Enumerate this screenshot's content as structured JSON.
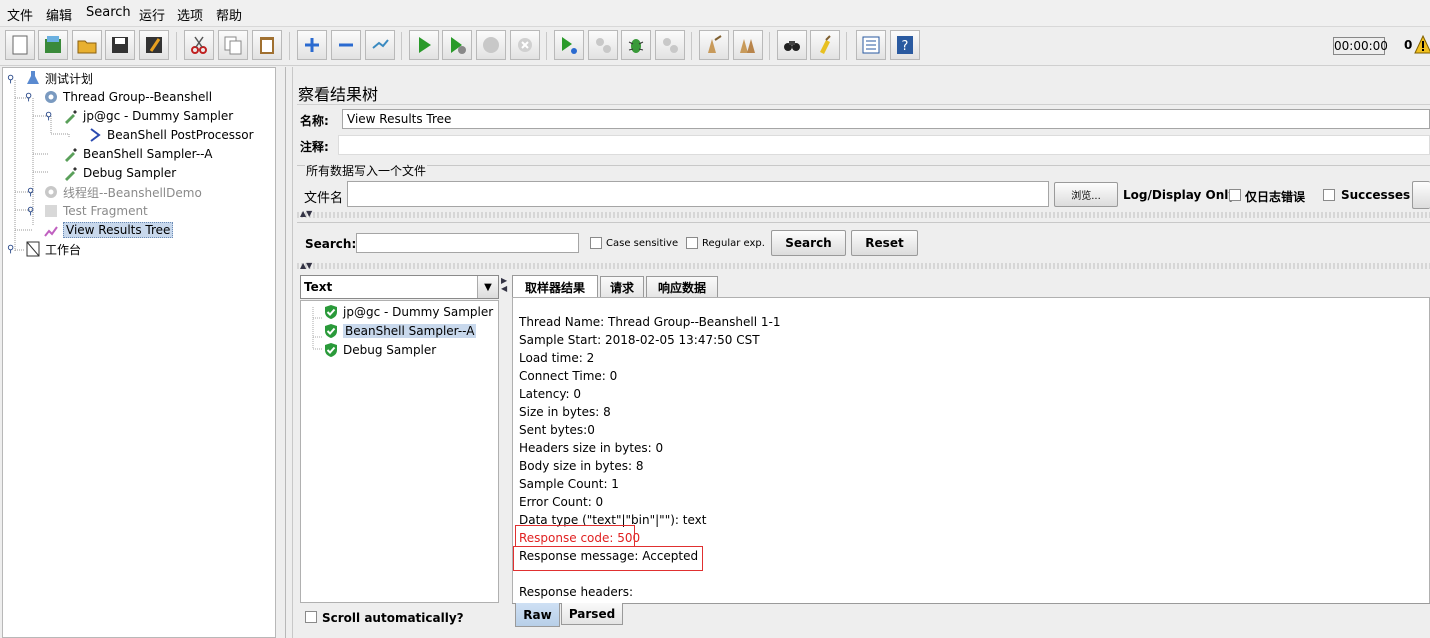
{
  "menu": [
    "文件",
    "编辑",
    "Search",
    "运行",
    "选项",
    "帮助"
  ],
  "toolbar": {
    "timer": "00:00:00",
    "warning_count": "0",
    "buttons": [
      "new-icon",
      "templates-icon",
      "open-icon",
      "save-icon",
      "save-as-icon",
      "cut-icon",
      "copy-icon",
      "paste-icon",
      "expand-icon",
      "collapse-icon",
      "toggle-icon",
      "start-icon",
      "start-no-pause-icon",
      "stop-icon",
      "shutdown-icon",
      "remote-start-icon",
      "remote-stop-icon",
      "remote-bug-icon",
      "remote-shutdown-icon",
      "clear-icon",
      "clear-all-icon",
      "search-icon",
      "reset-search-icon",
      "function-helper-icon",
      "help-icon"
    ]
  },
  "tree": [
    {
      "label": "测试计划",
      "icon": "flask-icon",
      "style": "normal"
    },
    {
      "label": "Thread Group--Beanshell",
      "icon": "gear-icon",
      "style": "normal"
    },
    {
      "label": "jp@gc - Dummy Sampler",
      "icon": "pipette-icon",
      "style": "normal"
    },
    {
      "label": "BeanShell PostProcessor",
      "icon": "arrow-icon",
      "style": "normal"
    },
    {
      "label": "BeanShell Sampler--A",
      "icon": "pipette-icon",
      "style": "normal"
    },
    {
      "label": "Debug Sampler",
      "icon": "pipette-icon",
      "style": "normal"
    },
    {
      "label": "线程组--BeanshellDemo",
      "icon": "gear-icon",
      "style": "disabled"
    },
    {
      "label": "Test Fragment",
      "icon": "fragment-icon",
      "style": "disabled"
    },
    {
      "label": "View Results Tree",
      "icon": "chart-icon",
      "style": "selected"
    },
    {
      "label": "工作台",
      "icon": "workbench-icon",
      "style": "normal"
    }
  ],
  "panel": {
    "title": "察看结果树",
    "name_label": "名称:",
    "name_value": "View Results Tree",
    "comment_label": "注释:",
    "comment_value": "",
    "file_section": "所有数据写入一个文件",
    "file_label": "文件名",
    "file_value": "",
    "browse_label": "浏览...",
    "log_display_label": "Log/Display Only:",
    "errors_only_label": "仅日志错误",
    "successes_label": "Successes"
  },
  "search": {
    "label": "Search:",
    "value": "",
    "case_sensitive_label": "Case sensitive",
    "regex_label": "Regular exp.",
    "search_button": "Search",
    "reset_button": "Reset"
  },
  "renderer": {
    "selected": "Text"
  },
  "results": [
    {
      "label": "jp@gc - Dummy Sampler",
      "status": "success"
    },
    {
      "label": "BeanShell Sampler--A",
      "status": "success",
      "selected": true
    },
    {
      "label": "Debug Sampler",
      "status": "success"
    }
  ],
  "scroll_auto_label": "Scroll automatically?",
  "tabs": [
    "取样器结果",
    "请求",
    "响应数据"
  ],
  "sampler_result": [
    "Thread Name: Thread Group--Beanshell 1-1",
    "Sample Start: 2018-02-05 13:47:50 CST",
    "Load time: 2",
    "Connect Time: 0",
    "Latency: 0",
    "Size in bytes: 8",
    "Sent bytes:0",
    "Headers size in bytes: 0",
    "Body size in bytes: 8",
    "Sample Count: 1",
    "Error Count: 0",
    "Data type (\"text\"|\"bin\"|\"\"): text",
    "Response code: 500",
    "Response message: Accepted",
    "",
    "Response headers:"
  ],
  "bottom_tabs": [
    "Raw",
    "Parsed"
  ],
  "colors": {
    "error_text": "#e02020",
    "selection": "#c8d8ec",
    "highlight_box": "#e03030"
  }
}
